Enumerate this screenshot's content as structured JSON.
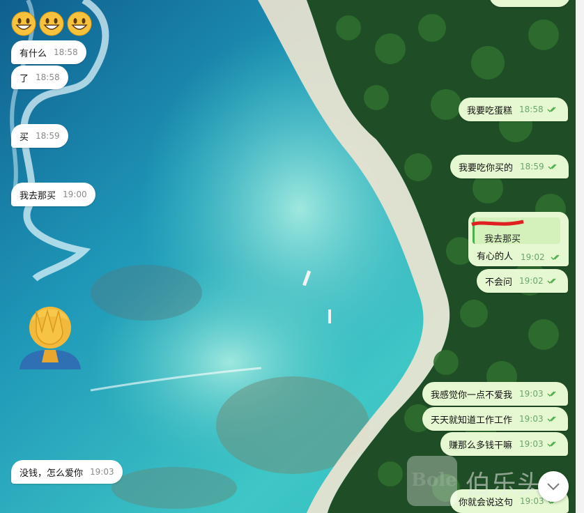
{
  "colors": {
    "incoming_bubble": "#ffffff",
    "outgoing_bubble": "#e6f8d2",
    "tick_green": "#4fae4e",
    "reply_bar": "#4caf50"
  },
  "incoming": [
    {
      "text": "有什么",
      "time": "18:58"
    },
    {
      "text": "了",
      "time": "18:58"
    },
    {
      "text": "买",
      "time": "18:59"
    },
    {
      "text": "我去那买",
      "time": "19:00"
    },
    {
      "text": "没钱，怎么爱你",
      "time": "19:03"
    }
  ],
  "outgoing": [
    {
      "text": "我要吃蛋糕",
      "time": "18:58"
    },
    {
      "text": "我要吃你买的",
      "time": "18:59"
    },
    {
      "text": "有心的人",
      "time": "19:02"
    },
    {
      "text": "不会问",
      "time": "19:02"
    },
    {
      "text": "我感觉你一点不爱我",
      "time": "19:03"
    },
    {
      "text": "天天就知道工作工作",
      "time": "19:03"
    },
    {
      "text": "赚那么多钱干嘛",
      "time": "19:03"
    },
    {
      "text": "你就会说这句",
      "time": "19:03"
    }
  ],
  "reply": {
    "quoted_text": "我去那买"
  },
  "emojis": {
    "top_row": [
      "grinning-face",
      "grinning-face",
      "grinning-face"
    ],
    "large": "facepalm-person"
  },
  "watermark": {
    "latin": "Bole",
    "cjk": "伯乐头条"
  },
  "scroll_button": {
    "icon": "chevron-down-icon"
  }
}
